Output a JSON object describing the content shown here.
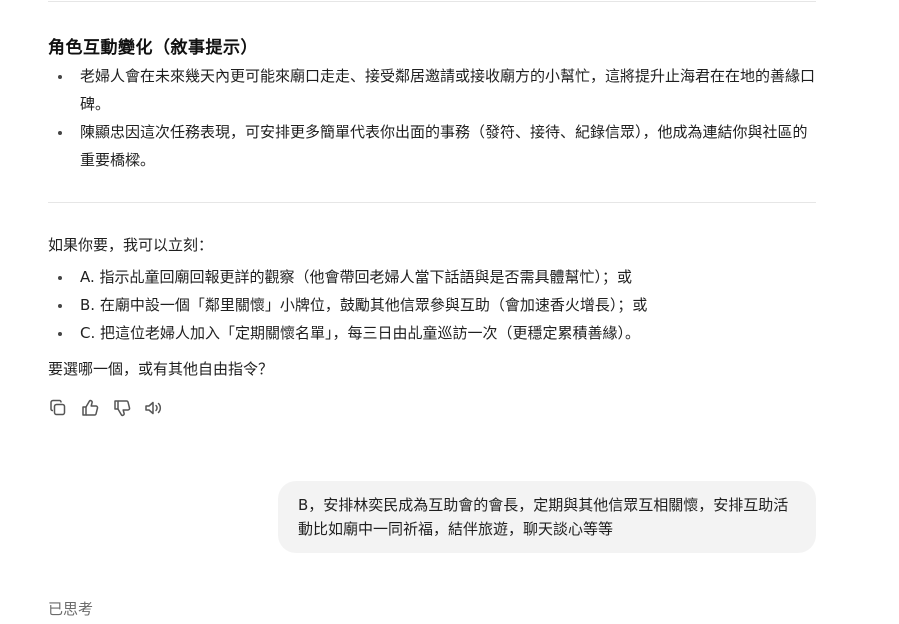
{
  "section": {
    "heading": "角色互動變化（敘事提示）",
    "bullets": [
      "老婦人會在未來幾天內更可能來廟口走走、接受鄰居邀請或接收廟方的小幫忙，這將提升止海君在在地的善緣口碑。",
      "陳顯忠因這次任務表現，可安排更多簡單代表你出面的事務（發符、接待、紀錄信眾），他成為連結你與社區的重要橋樑。"
    ]
  },
  "offer": {
    "intro": "如果你要，我可以立刻：",
    "options": [
      "A. 指示乩童回廟回報更詳的觀察（他會帶回老婦人當下話語與是否需具體幫忙）；或",
      "B. 在廟中設一個「鄰里關懷」小牌位，鼓勵其他信眾參與互助（會加速香火增長）；或",
      "C. 把這位老婦人加入「定期關懷名單」，每三日由乩童巡訪一次（更穩定累積善緣）。"
    ],
    "question": "要選哪一個，或有其他自由指令？"
  },
  "actions": {
    "icons": [
      "copy-icon",
      "thumbs-up-icon",
      "thumbs-down-icon",
      "read-aloud-icon"
    ]
  },
  "user_message": {
    "text": "B，安排林奕民成為互助會的會長，定期與其他信眾互相關懷，安排互助活動比如廟中一同祈福，結伴旅遊，聊天談心等等"
  },
  "status": {
    "thinking_label": "已思考"
  }
}
